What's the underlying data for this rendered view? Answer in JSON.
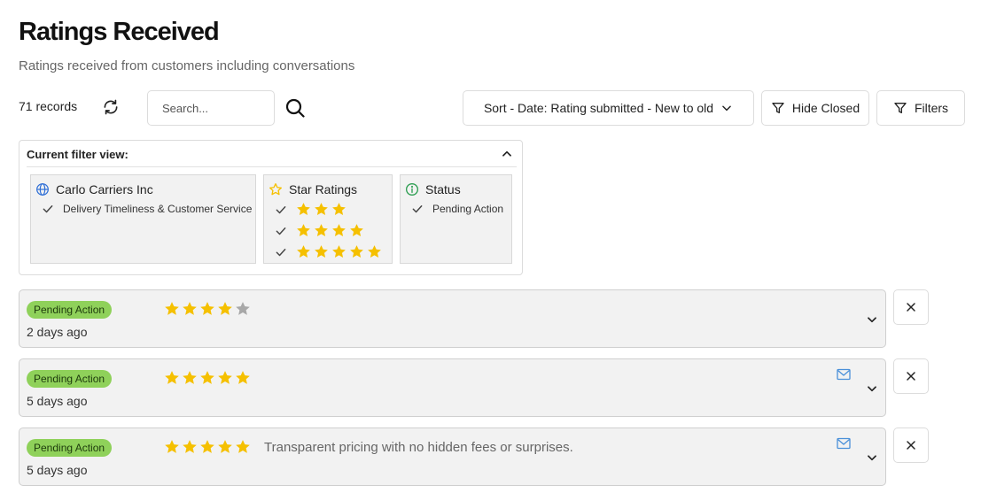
{
  "header": {
    "title": "Ratings Received",
    "subtitle": "Ratings received from customers including conversations"
  },
  "toolbar": {
    "record_count": "71 records",
    "search_placeholder": "Search...",
    "sort_label": "Sort - Date: Rating submitted - New to old",
    "hide_closed_label": "Hide Closed",
    "filters_label": "Filters"
  },
  "filter_view": {
    "title": "Current filter view:",
    "company": {
      "name": "Carlo Carriers Inc",
      "item": "Delivery Timeliness & Customer Service",
      "icon": "globe-icon"
    },
    "star_ratings": {
      "title": "Star Ratings",
      "levels": [
        3,
        4,
        5
      ],
      "icon": "star-outline-icon"
    },
    "status": {
      "title": "Status",
      "item": "Pending Action",
      "icon": "info-icon"
    }
  },
  "ratings": [
    {
      "status": "Pending Action",
      "stars": 4,
      "max_stars": 5,
      "time": "2 days ago",
      "comment": "",
      "has_message": false
    },
    {
      "status": "Pending Action",
      "stars": 5,
      "max_stars": 5,
      "time": "5 days ago",
      "comment": "",
      "has_message": true
    },
    {
      "status": "Pending Action",
      "stars": 5,
      "max_stars": 5,
      "time": "5 days ago",
      "comment": "Transparent pricing with no hidden fees or surprises.",
      "has_message": true
    }
  ],
  "colors": {
    "star_filled": "#f5c000",
    "star_empty": "#a8a8a8",
    "badge_bg": "#8fd15a",
    "mail_icon": "#4a90d9",
    "globe_icon": "#2f6fd6",
    "info_icon": "#2e9e52",
    "star_outline_icon": "#f5c000"
  }
}
